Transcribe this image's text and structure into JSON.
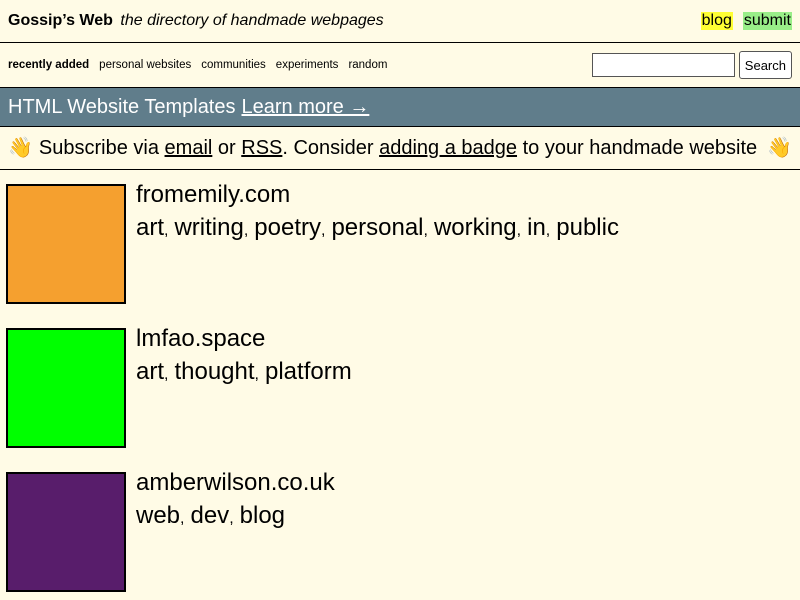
{
  "header": {
    "site_name": "Gossip’s Web",
    "tagline": "the directory of handmade webpages",
    "links": {
      "blog": "blog",
      "submit": "submit"
    },
    "link_colors": {
      "blog": "#ffff33",
      "submit": "#99ee88"
    }
  },
  "nav": {
    "items": [
      "recently added",
      "personal websites",
      "communities",
      "experiments",
      "random"
    ],
    "active": "recently added"
  },
  "search": {
    "value": "",
    "button": "Search"
  },
  "banner": {
    "text": "HTML Website Templates",
    "link": "Learn more →",
    "bg_color": "#607d8b"
  },
  "subscribe": {
    "hand_left": "👋",
    "hand_right": "👋",
    "prefix": "Subscribe via",
    "email_link": "email",
    "or": "or",
    "rss_link": "RSS",
    "consider": ". Consider",
    "badge_link": "adding a badge",
    "suffix": "to your handmade website"
  },
  "sites": [
    {
      "domain": "fromemily.com",
      "color": "#f5a02f",
      "tags": [
        "art",
        "writing",
        "poetry",
        "personal",
        "working",
        "in",
        "public"
      ]
    },
    {
      "domain": "lmfao.space",
      "color": "#00ff00",
      "tags": [
        "art",
        "thought",
        "platform"
      ]
    },
    {
      "domain": "amberwilson.co.uk",
      "color": "#581d6b",
      "tags": [
        "web",
        "dev",
        "blog"
      ]
    }
  ]
}
